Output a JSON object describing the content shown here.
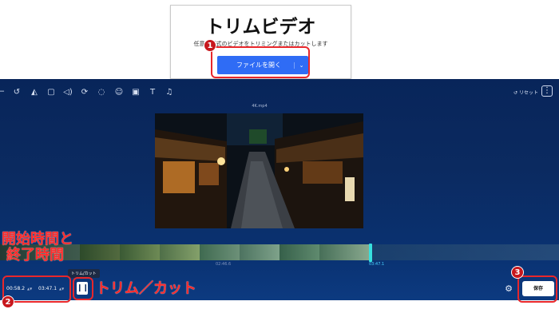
{
  "header": {
    "title": "トリムビデオ",
    "subtitle": "任意の形式のビデオをトリミングまたはカットします",
    "open_button": "ファイルを開く",
    "open_dropdown_glyph": "⌄"
  },
  "editor": {
    "reset_label": "リセット",
    "file_name": "4K.mp4",
    "trim_tooltip": "トリム/カット",
    "start_time": "00:58.2",
    "end_time": "03:47.1",
    "spin_glyph": "▲▼",
    "timeline_marks": [
      "02:46.6",
      "03:47.1"
    ],
    "save_label": "保存",
    "toolbar_icons": [
      "crop-icon",
      "rotate-icon",
      "flip-icon",
      "ratio-icon",
      "volume-icon",
      "loop-icon",
      "comment-icon",
      "sticker-icon",
      "image-icon",
      "text-icon",
      "audio-icon"
    ]
  },
  "annotations": {
    "badges": [
      "1",
      "2",
      "3"
    ],
    "start_end_label_line1": "開始時間と",
    "start_end_label_line2": "終了時間",
    "trim_cut_label": "トリム／カット"
  },
  "colors": {
    "accent_blue": "#2f6cf5",
    "editor_bg": "#0b2a60",
    "annotation_red": "#e8272b",
    "playhead": "#37e0df"
  }
}
